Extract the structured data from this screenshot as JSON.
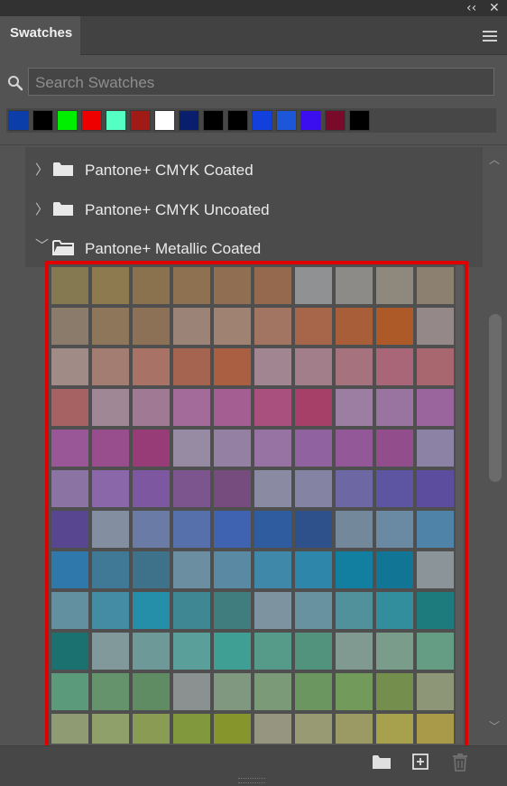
{
  "panel": {
    "title_controls": {
      "collapse": "‹‹",
      "close": "✕"
    },
    "tab_label": "Swatches"
  },
  "search": {
    "placeholder": "Search Swatches",
    "value": ""
  },
  "recent_colors": [
    "#0b3ea8",
    "#000000",
    "#00ee00",
    "#ee0000",
    "#55ffc4",
    "#a01a16",
    "#ffffff",
    "#0a1e6e",
    "#000000",
    "#000000",
    "#1240dc",
    "#1b57d8",
    "#3b0ef0",
    "#7a0a2a",
    "#000000"
  ],
  "groups": [
    {
      "label": "Pantone+ CMYK Coated",
      "expanded": false,
      "chevron": "〉"
    },
    {
      "label": "Pantone+ CMYK Uncoated",
      "expanded": false,
      "chevron": "〉"
    },
    {
      "label": "Pantone+ Metallic Coated",
      "expanded": true,
      "chevron": "﹀"
    }
  ],
  "swatch_grid": [
    "#857951",
    "#8d7a4e",
    "#8b724f",
    "#8d7151",
    "#906e52",
    "#95694e",
    "#8f9192",
    "#8c8b87",
    "#8e887d",
    "#8c8071",
    "#8b7b6a",
    "#8d7659",
    "#8d7156",
    "#9c8378",
    "#a08272",
    "#a27563",
    "#a7654a",
    "#a95e3a",
    "#ad5a28",
    "#958889",
    "#a08b86",
    "#a47d72",
    "#a87266",
    "#a56450",
    "#aa5f42",
    "#a18590",
    "#a27e8a",
    "#a6727e",
    "#a86678",
    "#a8676e",
    "#a66163",
    "#9f8795",
    "#a07a95",
    "#a26b9a",
    "#a45e92",
    "#a9507e",
    "#a64069",
    "#9b7ea1",
    "#9a74a0",
    "#9a649d",
    "#9a5798",
    "#984e8c",
    "#983c78",
    "#978aa3",
    "#9480a3",
    "#9673a3",
    "#9162a0",
    "#925898",
    "#924e8c",
    "#8c82a6",
    "#8b73a4",
    "#8a67a8",
    "#7d57a0",
    "#7c558f",
    "#764c7e",
    "#8a8aa2",
    "#8483a3",
    "#6d67a3",
    "#5d55a2",
    "#5c4d9e",
    "#584691",
    "#838ea0",
    "#6a7ca6",
    "#5570ab",
    "#3f63b0",
    "#2f5c9e",
    "#2e518c",
    "#74889b",
    "#6a8aa3",
    "#4f83a8",
    "#2f78ab",
    "#3f7995",
    "#3e728a",
    "#6c8ea1",
    "#5a8aa3",
    "#3f88aa",
    "#2f86ab",
    "#127ea0",
    "#117596",
    "#8a9499",
    "#6390a0",
    "#448ca3",
    "#258ea8",
    "#3e8793",
    "#3f7d7f",
    "#7d94a0",
    "#6892a0",
    "#50919c",
    "#328e9d",
    "#1d7b7d",
    "#1b716f",
    "#81999a",
    "#6d9999",
    "#5b9f9a",
    "#409f95",
    "#569b8a",
    "#52937d",
    "#809a91",
    "#7a9c8a",
    "#659c84",
    "#5b9a7b",
    "#65946c",
    "#5f8c63",
    "#8b9190",
    "#819880",
    "#7a9a78",
    "#6c9660",
    "#729a5b",
    "#748e4e",
    "#8e9678",
    "#8f9b73",
    "#8fa06a",
    "#8a9b54",
    "#82983d",
    "#87962c",
    "#969680",
    "#979a73",
    "#9b9a64",
    "#a7a04c",
    "#a99a4a"
  ],
  "footer": {
    "icons": [
      "folder-icon",
      "new-swatch-icon",
      "trash-icon"
    ]
  }
}
